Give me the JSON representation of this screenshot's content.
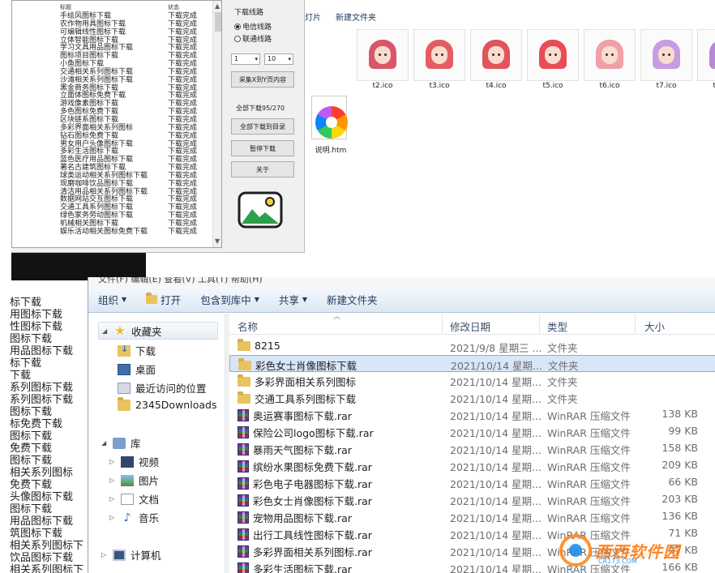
{
  "bg_window": {
    "toolbar": [
      "灯片",
      "新建文件夹"
    ],
    "icons": [
      {
        "name": "t2.ico",
        "hair": "#d9566a"
      },
      {
        "name": "t3.ico",
        "hair": "#e45d62"
      },
      {
        "name": "t4.ico",
        "hair": "#e2545c"
      },
      {
        "name": "t5.ico",
        "hair": "#ea4b57"
      },
      {
        "name": "t6.ico",
        "hair": "#f0a0a9"
      },
      {
        "name": "t7.ico",
        "hair": "#c99be0"
      },
      {
        "name": "t8.ico",
        "hair": "#b787d8"
      }
    ],
    "htm_name": "说明.htm"
  },
  "downloader": {
    "header": {
      "title": "标题",
      "status": "状态"
    },
    "rows": [
      [
        "手绘风图标下载",
        "下载完成"
      ],
      [
        "农作物用具图标下载",
        "下载完成"
      ],
      [
        "可编辑线性图标下载",
        "下载完成"
      ],
      [
        "立体智能图标下载",
        "下载完成"
      ],
      [
        "学习文具用品图标下载",
        "下载完成"
      ],
      [
        "图标项目图标下载",
        "下载完成"
      ],
      [
        "小鱼图标下载",
        "下载完成"
      ],
      [
        "交通相关系列图标下载",
        "下载完成"
      ],
      [
        "沙滩相关系列图标下载",
        "下载完成"
      ],
      [
        "黑金商务图标下载",
        "下载完成"
      ],
      [
        "立面体图标免费下载",
        "下载完成"
      ],
      [
        "游戏像素图标下载",
        "下载完成"
      ],
      [
        "多色图标免费下载",
        "下载完成"
      ],
      [
        "区块链系图标下载",
        "下载完成"
      ],
      [
        "多彩界面相关系列图标",
        "下载完成"
      ],
      [
        "钻石图标免费下载",
        "下载完成"
      ],
      [
        "男女用户头像图标下载",
        "下载完成"
      ],
      [
        "多彩生活图标下载",
        "下载完成"
      ],
      [
        "蓝色医疗用品图标下载",
        "下载完成"
      ],
      [
        "著名古建筑图标下载",
        "下载完成"
      ],
      [
        "球类运动相关系列图标下载",
        "下载完成"
      ],
      [
        "现磨咖啡饮品图标下载",
        "下载完成"
      ],
      [
        "清洁用品相关系列图标下载",
        "下载完成"
      ],
      [
        "数据网站交互图标下载",
        "下载完成"
      ],
      [
        "交通工具系列图标下载",
        "下载完成"
      ],
      [
        "绿色家务劳动图标下载",
        "下载完成"
      ],
      [
        "机械相关图标下载",
        "下载完成"
      ],
      [
        "娱乐活动相关图标免费下载",
        "下载完成"
      ]
    ],
    "line_label": "下载线路",
    "radio1": "电信线路",
    "radio2": "联通线路",
    "select1": "1",
    "select2": "10",
    "btn_collect": "采集X到Y页内容",
    "progress": "全部下载95/270",
    "btn_open": "全部下载到目录",
    "btn_pause": "暂停下载",
    "btn_about": "关于"
  },
  "left_text": [
    "标下载",
    "用图标下载",
    "性图标下载",
    "图标下载",
    "用品图标下载",
    "标下载",
    "下载",
    "系列图标下载",
    "系列图标下载",
    "图标下载",
    "标免费下载",
    "图标下载",
    "免费下载",
    "图标下载",
    "相关系列图标",
    "免费下载",
    "头像图标下载",
    "图标下载",
    "用品图标下载",
    "筑图标下载",
    "相关系列图标下",
    "饮品图标下载",
    "相关系列图标下"
  ],
  "explorer": {
    "menu_strip": "文件(F)   编辑(E)   查看(V)   工具(T)   帮助(H)",
    "cmdbar": {
      "organize": "组织",
      "open": "打开",
      "include": "包含到库中",
      "share": "共享",
      "new_folder": "新建文件夹"
    },
    "nav": {
      "favorites": "收藏夹",
      "downloads": "下载",
      "desktop": "桌面",
      "recent": "最近访问的位置",
      "folder_2345": "2345Downloads",
      "libraries": "库",
      "videos": "视频",
      "pictures": "图片",
      "documents": "文档",
      "music": "音乐",
      "computer": "计算机"
    },
    "columns": {
      "name": "名称",
      "date": "修改日期",
      "type": "类型",
      "size": "大小"
    },
    "files": [
      {
        "kind": "folder",
        "name": "8215",
        "date": "2021/9/8 星期三 ...",
        "type": "文件夹",
        "size": ""
      },
      {
        "kind": "folder",
        "name": "彩色女士肖像图标下载",
        "date": "2021/10/14 星期...",
        "type": "文件夹",
        "size": "",
        "selected": true
      },
      {
        "kind": "folder",
        "name": "多彩界面相关系列图标",
        "date": "2021/10/14 星期...",
        "type": "文件夹",
        "size": ""
      },
      {
        "kind": "folder",
        "name": "交通工具系列图标下载",
        "date": "2021/10/14 星期...",
        "type": "文件夹",
        "size": ""
      },
      {
        "kind": "rar",
        "name": "奥运赛事图标下载.rar",
        "date": "2021/10/14 星期...",
        "type": "WinRAR 压缩文件",
        "size": "138 KB"
      },
      {
        "kind": "rar",
        "name": "保险公司logo图标下载.rar",
        "date": "2021/10/14 星期...",
        "type": "WinRAR 压缩文件",
        "size": "99 KB"
      },
      {
        "kind": "rar",
        "name": "暴雨天气图标下载.rar",
        "date": "2021/10/14 星期...",
        "type": "WinRAR 压缩文件",
        "size": "158 KB"
      },
      {
        "kind": "rar",
        "name": "缤纷水果图标免费下载.rar",
        "date": "2021/10/14 星期...",
        "type": "WinRAR 压缩文件",
        "size": "209 KB"
      },
      {
        "kind": "rar",
        "name": "彩色电子电器图标下载.rar",
        "date": "2021/10/14 星期...",
        "type": "WinRAR 压缩文件",
        "size": "66 KB"
      },
      {
        "kind": "rar",
        "name": "彩色女士肖像图标下载.rar",
        "date": "2021/10/14 星期...",
        "type": "WinRAR 压缩文件",
        "size": "203 KB"
      },
      {
        "kind": "rar",
        "name": "宠物用品图标下载.rar",
        "date": "2021/10/14 星期...",
        "type": "WinRAR 压缩文件",
        "size": "136 KB"
      },
      {
        "kind": "rar",
        "name": "出行工具线性图标下载.rar",
        "date": "2021/10/14 星期...",
        "type": "WinRAR 压缩文件",
        "size": "71 KB"
      },
      {
        "kind": "rar",
        "name": "多彩界面相关系列图标.rar",
        "date": "2021/10/14 星期...",
        "type": "WinRAR 压缩文件",
        "size": "97 KB"
      },
      {
        "kind": "rar",
        "name": "多彩生活图标下载.rar",
        "date": "2021/10/14 星期...",
        "type": "WinRAR 压缩文件",
        "size": "166 KB"
      }
    ]
  },
  "watermark": {
    "text": "西西软件园",
    "sub": "CR173.COM"
  }
}
